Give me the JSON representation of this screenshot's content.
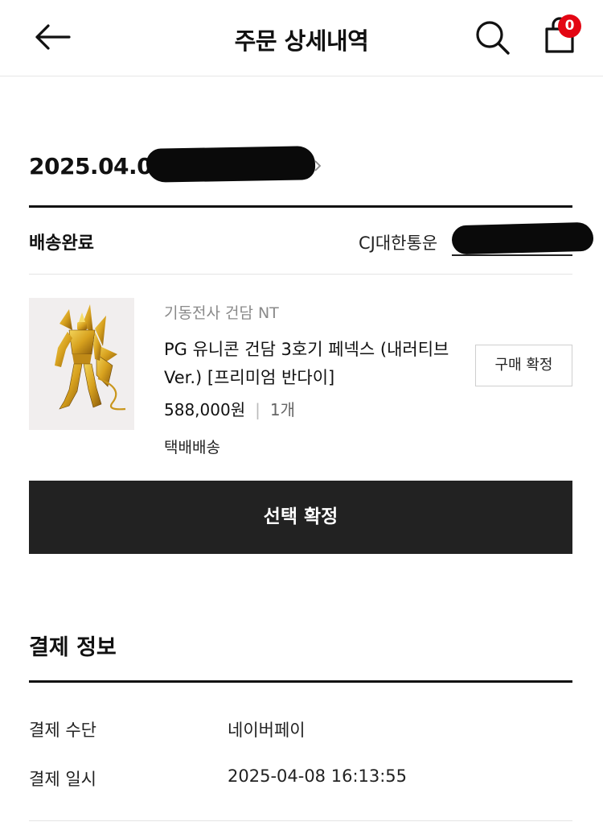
{
  "header": {
    "title": "주문 상세내역",
    "cart_count": "0"
  },
  "order": {
    "date": "2025.04.08",
    "status": "배송완료",
    "carrier": "CJ대한통운"
  },
  "product": {
    "brand": "기동전사 건담 NT",
    "name": "PG 유니콘 건담 3호기 페넥스 (내러티브 Ver.) [프리미엄 반다이]",
    "price": "588,000원",
    "separator": "|",
    "quantity": "1개",
    "shipping": "택배배송",
    "confirm_label": "구매 확정"
  },
  "select_confirm_label": "선택 확정",
  "payment": {
    "title": "결제 정보",
    "rows": [
      {
        "label": "결제 수단",
        "value": "네이버페이"
      },
      {
        "label": "결제 일시",
        "value": "2025-04-08 16:13:55"
      }
    ]
  },
  "colors": {
    "badge": "#e30613",
    "primary_button": "#222222",
    "product_bg": "#f1eeee"
  },
  "icons": [
    "back-arrow-icon",
    "search-icon",
    "shopping-bag-icon",
    "chevron-right-icon"
  ]
}
